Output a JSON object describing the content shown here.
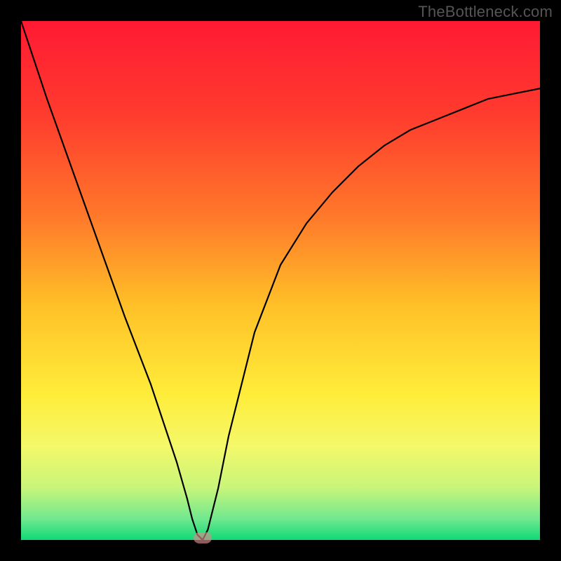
{
  "watermark": "TheBottleneck.com",
  "chart_data": {
    "type": "line",
    "title": "",
    "x": [
      0,
      2,
      5,
      10,
      15,
      20,
      25,
      28,
      30,
      32,
      33,
      34,
      35,
      36,
      38,
      40,
      45,
      50,
      55,
      60,
      65,
      70,
      75,
      80,
      85,
      90,
      95,
      100
    ],
    "y": [
      100,
      94,
      85,
      71,
      57,
      43,
      30,
      21,
      15,
      8,
      4,
      1,
      0,
      2,
      10,
      20,
      40,
      53,
      61,
      67,
      72,
      76,
      79,
      81,
      83,
      85,
      86,
      87
    ],
    "xlim": [
      0,
      100
    ],
    "ylim": [
      0,
      100
    ],
    "xlabel": "",
    "ylabel": "",
    "marker_point": {
      "x": 35,
      "y": 0
    },
    "marker_color": "#d98c8c",
    "background_gradient": {
      "stops": [
        {
          "offset": 0.0,
          "color": "#ff1a33"
        },
        {
          "offset": 0.18,
          "color": "#ff3b2e"
        },
        {
          "offset": 0.38,
          "color": "#ff7a2a"
        },
        {
          "offset": 0.55,
          "color": "#ffc128"
        },
        {
          "offset": 0.72,
          "color": "#ffed3a"
        },
        {
          "offset": 0.82,
          "color": "#f4f86a"
        },
        {
          "offset": 0.9,
          "color": "#c8f57a"
        },
        {
          "offset": 0.96,
          "color": "#6fe88f"
        },
        {
          "offset": 1.0,
          "color": "#10d977"
        }
      ]
    }
  }
}
